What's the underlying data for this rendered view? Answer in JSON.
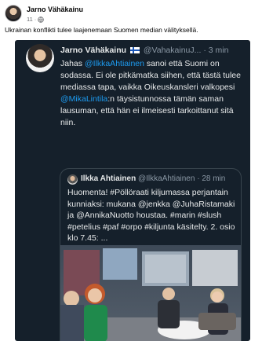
{
  "post": {
    "author": "Jarno Vähäkainu",
    "time": "11",
    "privacy_icon": "globe-icon",
    "text": "Ukrainan konflikti tulee laajenemaan Suomen median välityksellä."
  },
  "tweet": {
    "name": "Jarno Vähäkainu",
    "handle": "@VahakainuJ...",
    "sep": "·",
    "time": "3 min",
    "text_1": "Jahas ",
    "mention_1": "@IlkkaAhtiainen",
    "text_2": " sanoi että Suomi on sodassa. Ei ole pitkämatka siihen, että tästä tulee mediassa tapa, vaikka Oikeuskansleri valkopesi ",
    "mention_2": "@MikaLintila",
    "text_3": ":n täysistunnossa tämän saman lausuman, että hän ei ilmeisesti tarkoittanut sitä niin."
  },
  "quote": {
    "name": "Ilkka Ahtiainen",
    "handle": "@IlkkaAhtiainen",
    "sep": "·",
    "time": "28 min",
    "text": "Huomenta! #Pöllöraati kiljumassa perjantain kunniaksi: mukana @jenkka @JuhaRistamaki ja @AnnikaNuotto houstaa. #marin #slush #petelius #paf #orpo #kiljunta käsitelty. 2. osio klo 7.45: ..."
  },
  "colors": {
    "tweet_bg": "#15202b",
    "link": "#1d9bf0",
    "muted": "#8b98a5"
  }
}
